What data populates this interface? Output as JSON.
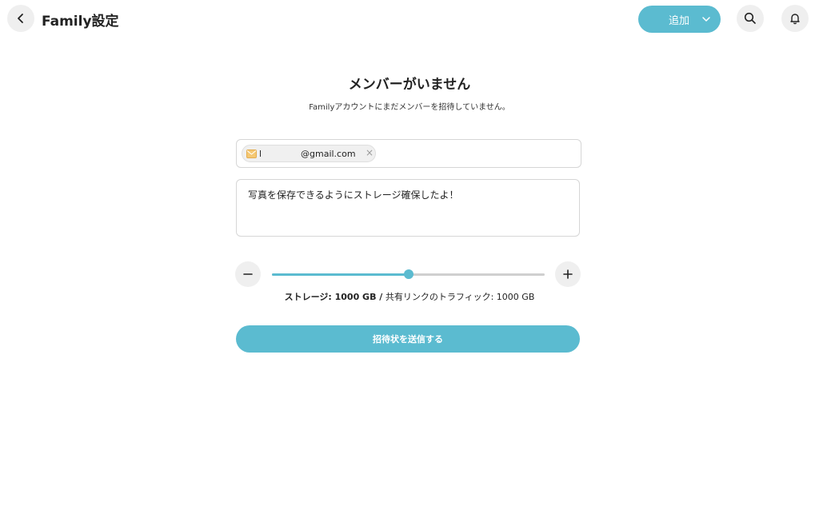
{
  "header": {
    "title": "Family設定",
    "add_label": "追加"
  },
  "empty_state": {
    "title": "メンバーがいません",
    "subtitle": "Familyアカウントにまだメンバーを招待していません。"
  },
  "invite": {
    "email_chip": "l              @gmail.com",
    "remove_symbol": "×",
    "message": "写真を保存できるようにストレージ確保したよ！"
  },
  "storage": {
    "label_bold": "ストレージ: 1000 GB /",
    "label_rest": " 共有リンクのトラフィック: 1000 GB",
    "slider_fraction": 0.5
  },
  "send_button": "招待状を送信する",
  "colors": {
    "accent": "#5bbbd0",
    "icon_bg": "#efefef"
  },
  "icons": {
    "back": "chevron-left-icon",
    "dropdown": "chevron-down-icon",
    "search": "search-icon",
    "bell": "bell-icon",
    "mail": "mail-icon",
    "minus": "minus-icon",
    "plus": "plus-icon"
  }
}
